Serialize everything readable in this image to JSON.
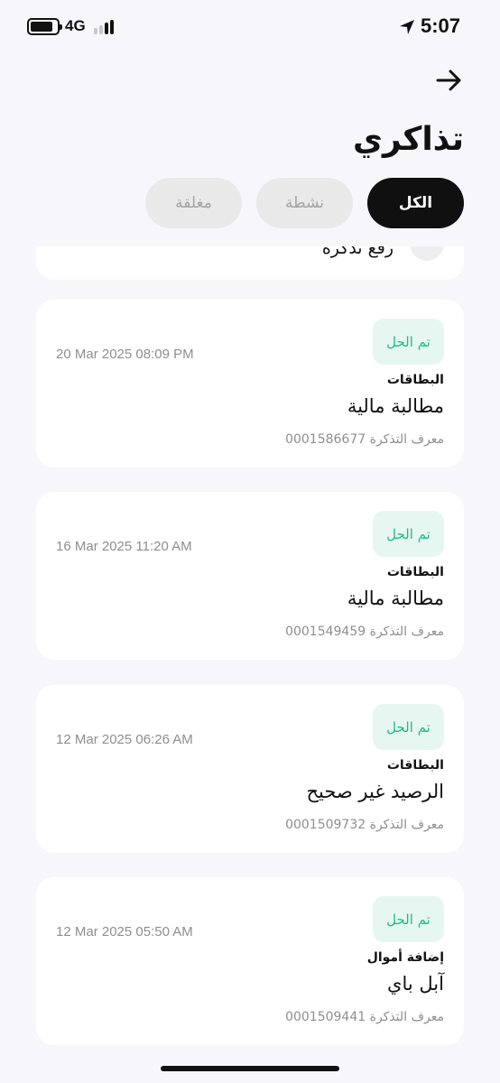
{
  "status_bar": {
    "network": "4G",
    "time": "5:07"
  },
  "header": {
    "title": "تذاكري"
  },
  "tabs": [
    {
      "label": "الكل",
      "active": true
    },
    {
      "label": "نشطة",
      "active": false
    },
    {
      "label": "مغلقة",
      "active": false
    }
  ],
  "partial_item": {
    "label": "رفع تذكرة"
  },
  "tickets": [
    {
      "status": "تم الحل",
      "date": "20 Mar 2025 08:09 PM",
      "category": "البطاقات",
      "title": "مطالبة مالية",
      "id_text": "معرف التذكرة 0001586677"
    },
    {
      "status": "تم الحل",
      "date": "16 Mar 2025 11:20 AM",
      "category": "البطاقات",
      "title": "مطالبة مالية",
      "id_text": "معرف التذكرة 0001549459"
    },
    {
      "status": "تم الحل",
      "date": "12 Mar 2025 06:26 AM",
      "category": "البطاقات",
      "title": "الرصيد غير صحيح",
      "id_text": "معرف التذكرة 0001509732"
    },
    {
      "status": "تم الحل",
      "date": "12 Mar 2025 05:50 AM",
      "category": "إضافة أموال",
      "title": "آبل باي",
      "id_text": "معرف التذكرة 0001509441"
    }
  ],
  "colors": {
    "background": "#f7f7fb",
    "active_tab": "#101010",
    "badge_bg": "#e6f7f2",
    "badge_text": "#1dbb87"
  }
}
